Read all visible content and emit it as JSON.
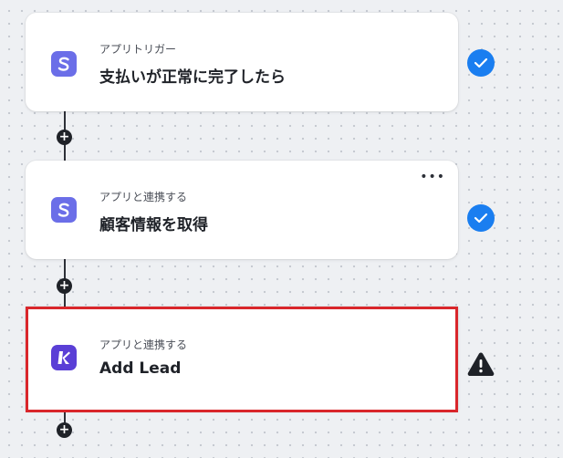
{
  "workflow": {
    "steps": [
      {
        "subtitle": "アプリトリガー",
        "title": "支払いが正常に完了したら",
        "app_icon": "stripe-s-icon",
        "icon_letter": "S",
        "icon_color": "#6b6ee8",
        "status": "completed",
        "status_icon": "check-circle-icon"
      },
      {
        "subtitle": "アプリと連携する",
        "title": "顧客情報を取得",
        "app_icon": "stripe-s-icon",
        "icon_letter": "S",
        "icon_color": "#6b6ee8",
        "status": "completed",
        "status_icon": "check-circle-icon",
        "menu_label": "•••"
      },
      {
        "subtitle": "アプリと連携する",
        "title": "Add Lead",
        "app_icon": "kommo-k-icon",
        "icon_color": "#5a3fd6",
        "status": "warning",
        "status_icon": "warning-triangle-icon",
        "selected": true,
        "highlight_color": "#d9262b"
      }
    ],
    "add_step_label": "+",
    "colors": {
      "check": "#1a7ef0",
      "warning": "#1f2228",
      "connector": "#2d3038"
    }
  }
}
